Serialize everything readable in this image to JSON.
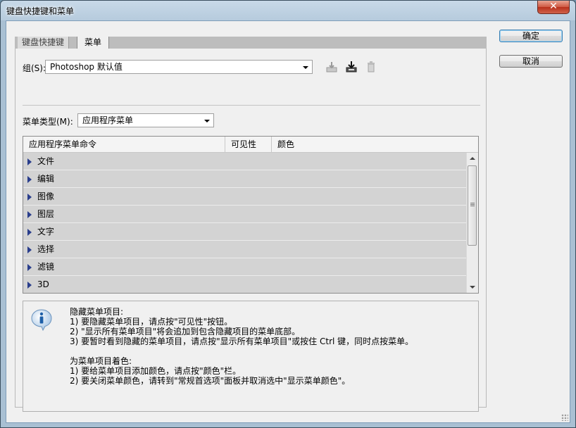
{
  "window": {
    "title": "键盘快捷键和菜单",
    "close_glyph": "✕"
  },
  "tabs": [
    {
      "label": "键盘快捷键"
    },
    {
      "label": "菜单"
    }
  ],
  "group": {
    "label": "组(S):",
    "label_accel": "S",
    "value": "Photoshop 默认值"
  },
  "menu_type": {
    "label": "菜单类型(M):",
    "label_accel": "M",
    "value": "应用程序菜单"
  },
  "table": {
    "headers": [
      "应用程序菜单命令",
      "可见性",
      "颜色"
    ],
    "rows": [
      {
        "label": "文件"
      },
      {
        "label": "编辑"
      },
      {
        "label": "图像"
      },
      {
        "label": "图层"
      },
      {
        "label": "文字"
      },
      {
        "label": "选择"
      },
      {
        "label": "滤镜"
      },
      {
        "label": "3D"
      }
    ]
  },
  "info": {
    "text": "隐藏菜单项目:\n1) 要隐藏菜单项目，请点按\"可见性\"按钮。\n2) \"显示所有菜单项目\"将会追加到包含隐藏项目的菜单底部。\n3) 要暂时看到隐藏的菜单项目，请点按\"显示所有菜单项目\"或按住 Ctrl 键，同时点按菜单。\n\n为菜单项目着色:\n1) 要给菜单项目添加颜色，请点按\"颜色\"栏。\n2) 要关闭菜单颜色，请转到\"常规首选项\"面板并取消选中\"显示菜单颜色\"。"
  },
  "buttons": {
    "ok": "确定",
    "cancel": "取消"
  },
  "icons": {
    "save": "save-set-icon",
    "save_as": "new-set-icon",
    "delete": "delete-set-icon",
    "info": "info-icon"
  },
  "colors": {
    "row_bg": "#d3d3d3",
    "expand_arrow": "#2a3e8c"
  }
}
